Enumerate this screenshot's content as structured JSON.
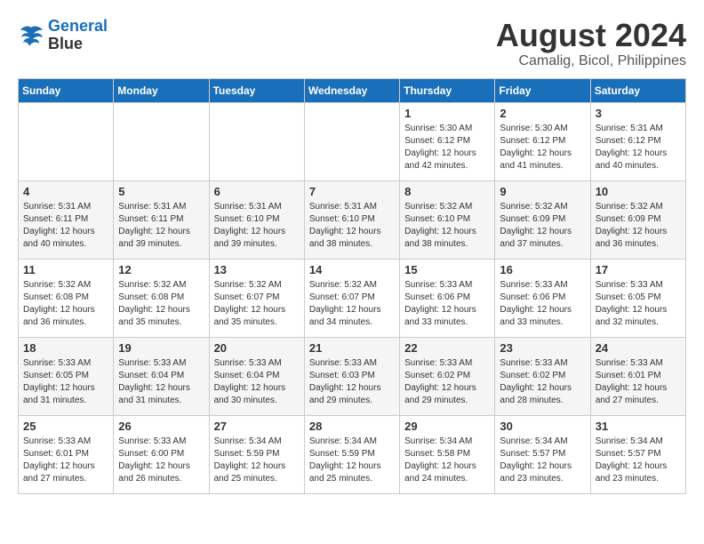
{
  "logo": {
    "line1": "General",
    "line2": "Blue"
  },
  "title": "August 2024",
  "subtitle": "Camalig, Bicol, Philippines",
  "days_of_week": [
    "Sunday",
    "Monday",
    "Tuesday",
    "Wednesday",
    "Thursday",
    "Friday",
    "Saturday"
  ],
  "weeks": [
    [
      {
        "day": "",
        "info": ""
      },
      {
        "day": "",
        "info": ""
      },
      {
        "day": "",
        "info": ""
      },
      {
        "day": "",
        "info": ""
      },
      {
        "day": "1",
        "info": "Sunrise: 5:30 AM\nSunset: 6:12 PM\nDaylight: 12 hours\nand 42 minutes."
      },
      {
        "day": "2",
        "info": "Sunrise: 5:30 AM\nSunset: 6:12 PM\nDaylight: 12 hours\nand 41 minutes."
      },
      {
        "day": "3",
        "info": "Sunrise: 5:31 AM\nSunset: 6:12 PM\nDaylight: 12 hours\nand 40 minutes."
      }
    ],
    [
      {
        "day": "4",
        "info": "Sunrise: 5:31 AM\nSunset: 6:11 PM\nDaylight: 12 hours\nand 40 minutes."
      },
      {
        "day": "5",
        "info": "Sunrise: 5:31 AM\nSunset: 6:11 PM\nDaylight: 12 hours\nand 39 minutes."
      },
      {
        "day": "6",
        "info": "Sunrise: 5:31 AM\nSunset: 6:10 PM\nDaylight: 12 hours\nand 39 minutes."
      },
      {
        "day": "7",
        "info": "Sunrise: 5:31 AM\nSunset: 6:10 PM\nDaylight: 12 hours\nand 38 minutes."
      },
      {
        "day": "8",
        "info": "Sunrise: 5:32 AM\nSunset: 6:10 PM\nDaylight: 12 hours\nand 38 minutes."
      },
      {
        "day": "9",
        "info": "Sunrise: 5:32 AM\nSunset: 6:09 PM\nDaylight: 12 hours\nand 37 minutes."
      },
      {
        "day": "10",
        "info": "Sunrise: 5:32 AM\nSunset: 6:09 PM\nDaylight: 12 hours\nand 36 minutes."
      }
    ],
    [
      {
        "day": "11",
        "info": "Sunrise: 5:32 AM\nSunset: 6:08 PM\nDaylight: 12 hours\nand 36 minutes."
      },
      {
        "day": "12",
        "info": "Sunrise: 5:32 AM\nSunset: 6:08 PM\nDaylight: 12 hours\nand 35 minutes."
      },
      {
        "day": "13",
        "info": "Sunrise: 5:32 AM\nSunset: 6:07 PM\nDaylight: 12 hours\nand 35 minutes."
      },
      {
        "day": "14",
        "info": "Sunrise: 5:32 AM\nSunset: 6:07 PM\nDaylight: 12 hours\nand 34 minutes."
      },
      {
        "day": "15",
        "info": "Sunrise: 5:33 AM\nSunset: 6:06 PM\nDaylight: 12 hours\nand 33 minutes."
      },
      {
        "day": "16",
        "info": "Sunrise: 5:33 AM\nSunset: 6:06 PM\nDaylight: 12 hours\nand 33 minutes."
      },
      {
        "day": "17",
        "info": "Sunrise: 5:33 AM\nSunset: 6:05 PM\nDaylight: 12 hours\nand 32 minutes."
      }
    ],
    [
      {
        "day": "18",
        "info": "Sunrise: 5:33 AM\nSunset: 6:05 PM\nDaylight: 12 hours\nand 31 minutes."
      },
      {
        "day": "19",
        "info": "Sunrise: 5:33 AM\nSunset: 6:04 PM\nDaylight: 12 hours\nand 31 minutes."
      },
      {
        "day": "20",
        "info": "Sunrise: 5:33 AM\nSunset: 6:04 PM\nDaylight: 12 hours\nand 30 minutes."
      },
      {
        "day": "21",
        "info": "Sunrise: 5:33 AM\nSunset: 6:03 PM\nDaylight: 12 hours\nand 29 minutes."
      },
      {
        "day": "22",
        "info": "Sunrise: 5:33 AM\nSunset: 6:02 PM\nDaylight: 12 hours\nand 29 minutes."
      },
      {
        "day": "23",
        "info": "Sunrise: 5:33 AM\nSunset: 6:02 PM\nDaylight: 12 hours\nand 28 minutes."
      },
      {
        "day": "24",
        "info": "Sunrise: 5:33 AM\nSunset: 6:01 PM\nDaylight: 12 hours\nand 27 minutes."
      }
    ],
    [
      {
        "day": "25",
        "info": "Sunrise: 5:33 AM\nSunset: 6:01 PM\nDaylight: 12 hours\nand 27 minutes."
      },
      {
        "day": "26",
        "info": "Sunrise: 5:33 AM\nSunset: 6:00 PM\nDaylight: 12 hours\nand 26 minutes."
      },
      {
        "day": "27",
        "info": "Sunrise: 5:34 AM\nSunset: 5:59 PM\nDaylight: 12 hours\nand 25 minutes."
      },
      {
        "day": "28",
        "info": "Sunrise: 5:34 AM\nSunset: 5:59 PM\nDaylight: 12 hours\nand 25 minutes."
      },
      {
        "day": "29",
        "info": "Sunrise: 5:34 AM\nSunset: 5:58 PM\nDaylight: 12 hours\nand 24 minutes."
      },
      {
        "day": "30",
        "info": "Sunrise: 5:34 AM\nSunset: 5:57 PM\nDaylight: 12 hours\nand 23 minutes."
      },
      {
        "day": "31",
        "info": "Sunrise: 5:34 AM\nSunset: 5:57 PM\nDaylight: 12 hours\nand 23 minutes."
      }
    ]
  ]
}
